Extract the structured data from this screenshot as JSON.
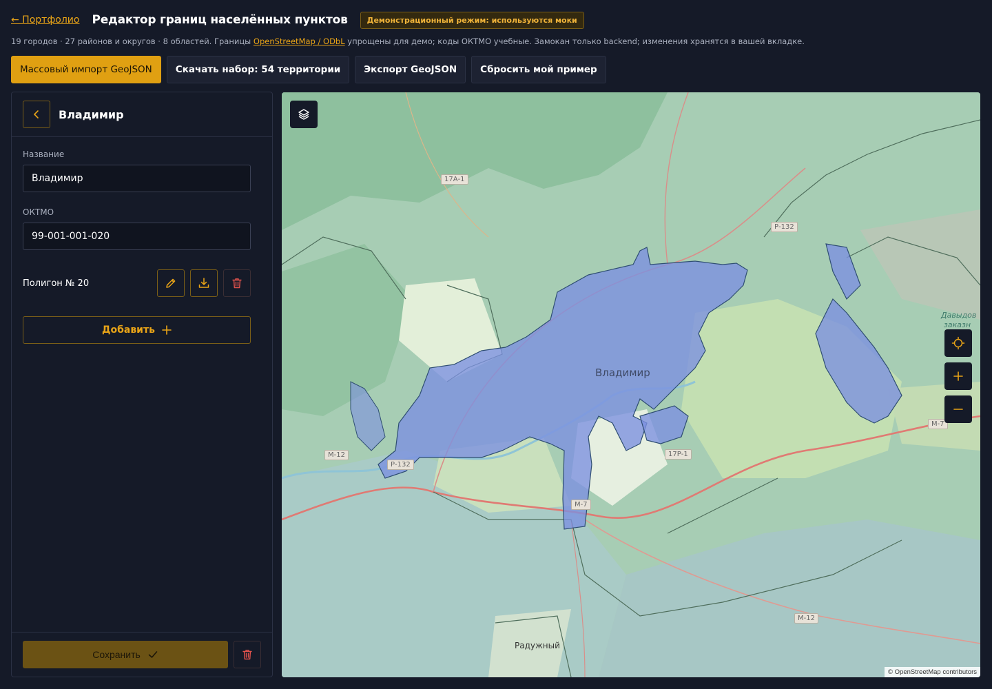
{
  "header": {
    "back_label": "← Портфолио",
    "title": "Редактор границ населённых пунктов",
    "demo_badge": "Демонстрационный режим: используются моки"
  },
  "subline": {
    "text_before": "19 городов · 27 районов и округов · 8 областей. Границы ",
    "link": "OpenStreetMap / ODbL",
    "text_after": " упрощены для демо; коды ОКТМО учебные. Замокан только backend; изменения хранятся в вашей вкладке."
  },
  "toolbar": {
    "import_label": "Массовый импорт GeoJSON",
    "download_label": "Скачать набор: 54 территории",
    "export_label": "Экспорт GeoJSON",
    "reset_label": "Сбросить мой пример"
  },
  "sidebar": {
    "title": "Владимир",
    "name_label": "Название",
    "name_value": "Владимир",
    "oktmo_label": "ОКТМО",
    "oktmo_value": "99-001-001-020",
    "polygon_label": "Полигон № 20",
    "add_label": "Добавить",
    "save_label": "Сохранить"
  },
  "map": {
    "city_label": "Владимир",
    "town_label": "Радужный",
    "region_label_1": "Давыдов",
    "region_label_2": "заказн",
    "attribution": "© OpenStreetMap contributors",
    "roads": [
      "17А-1",
      "Р-132",
      "М-12",
      "Р-132",
      "М-7",
      "17Р-1",
      "М-7",
      "М-12"
    ]
  },
  "colors": {
    "accent": "#e0a012",
    "background": "#151a28",
    "polygon_fill": "#7b8fe0",
    "danger": "#e0524c"
  }
}
